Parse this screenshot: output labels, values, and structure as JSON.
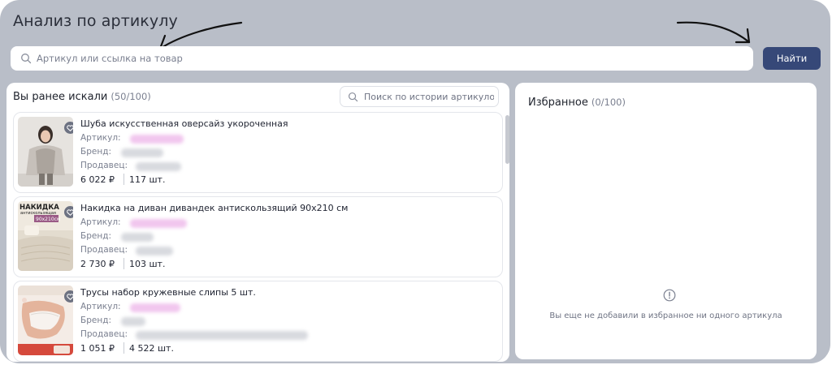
{
  "page": {
    "title": "Анализ по артикулу"
  },
  "search": {
    "placeholder": "Артикул или ссылка на товар",
    "button_label": "Найти"
  },
  "history": {
    "title": "Вы ранее искали",
    "count": "(50/100)",
    "search_placeholder": "Поиск по истории артикулов",
    "labels": {
      "sku": "Артикул:",
      "brand": "Бренд:",
      "seller": "Продавец:"
    },
    "items": [
      {
        "name": "Шуба искусственная оверсайз укороченная",
        "price": "6 022 ₽",
        "quantity": "117 шт."
      },
      {
        "name": "Накидка на диван дивандек антискользящий 90х210 см",
        "price": "2 730 ₽",
        "quantity": "103 шт.",
        "image_text": [
          "НАКИДКА",
          "антискользящая",
          "90х210см"
        ]
      },
      {
        "name": "Трусы набор кружевные слипы 5 шт.",
        "price": "1 051 ₽",
        "quantity": "4 522 шт."
      }
    ]
  },
  "favorites": {
    "title": "Избранное",
    "count": "(0/100)",
    "empty_text": "Вы еще не добавили в избранное ни одного артикула"
  },
  "colors": {
    "background": "#b9bec8",
    "accent_button": "#364878",
    "blurred_sku": "#f1c6ee",
    "blurred_text": "#d8dadf"
  },
  "icons": [
    "search-icon",
    "heart-icon",
    "info-icon"
  ]
}
